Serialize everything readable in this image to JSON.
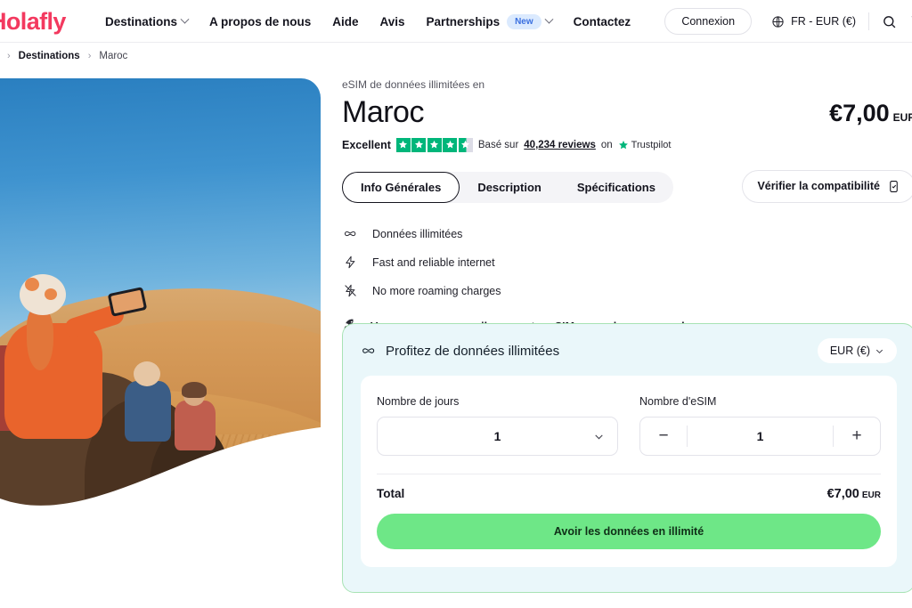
{
  "header": {
    "logo": "Holafly",
    "nav": [
      {
        "label": "Destinations",
        "caret": true,
        "badge": null
      },
      {
        "label": "A propos de nous",
        "caret": false,
        "badge": null
      },
      {
        "label": "Aide",
        "caret": false,
        "badge": null
      },
      {
        "label": "Avis",
        "caret": false,
        "badge": null
      },
      {
        "label": "Partnerships",
        "caret": true,
        "badge": "New"
      },
      {
        "label": "Contactez",
        "caret": false,
        "badge": null
      }
    ],
    "login_label": "Connexion",
    "language": "FR - EUR (€)",
    "globe_icon": "globe-icon",
    "search_icon": "search-icon",
    "cart_icon": "cart-icon"
  },
  "breadcrumb": {
    "separator": "›",
    "items": [
      {
        "label": "Destinations",
        "current": false
      },
      {
        "label": "Maroc",
        "current": true
      }
    ]
  },
  "hero": {
    "alt": "Tourists riding camels in the Moroccan desert"
  },
  "product": {
    "eyebrow": "eSIM de données illimitées en",
    "title": "Maroc",
    "price": "€7,00",
    "price_currency": "EUR",
    "rating": {
      "label": "Excellent",
      "stars_filled": 4,
      "stars_half": 1,
      "prefix": "Basé sur",
      "reviews": "40,234 reviews",
      "on": "on",
      "platform": "Trustpilot",
      "star_color": "#00b67a"
    },
    "tabs": [
      {
        "label": "Info Générales",
        "active": true
      },
      {
        "label": "Description",
        "active": false
      },
      {
        "label": "Spécifications",
        "active": false
      }
    ],
    "compat_button": "Vérifier la compatibilité",
    "compat_icon": "device-check-icon",
    "features": [
      {
        "icon": "infinity-icon",
        "text": "Données illimitées"
      },
      {
        "icon": "bolt-icon",
        "text": "Fast and reliable internet"
      },
      {
        "icon": "bolt-slash-icon",
        "text": "No more roaming charges"
      }
    ],
    "note": {
      "icon": "rocket-icon",
      "text": "Vous recevrez un mail avec votre eSIM en quelques secondes."
    }
  },
  "pricing": {
    "heading": "Profitez de données illimitées",
    "heading_icon": "infinity-icon",
    "currency_selector": "EUR (€)",
    "days_label": "Nombre de jours",
    "days_value": "1",
    "esim_label": "Nombre d'eSIM",
    "esim_value": "1",
    "minus_label": "−",
    "plus_label": "+",
    "total_label": "Total",
    "total_value": "€7,00",
    "total_currency": "EUR",
    "cta_label": "Avoir les données en illimité",
    "cta_color": "#6ee787",
    "box_bg": "#eaf7fa",
    "box_border": "#a8e3b4"
  }
}
